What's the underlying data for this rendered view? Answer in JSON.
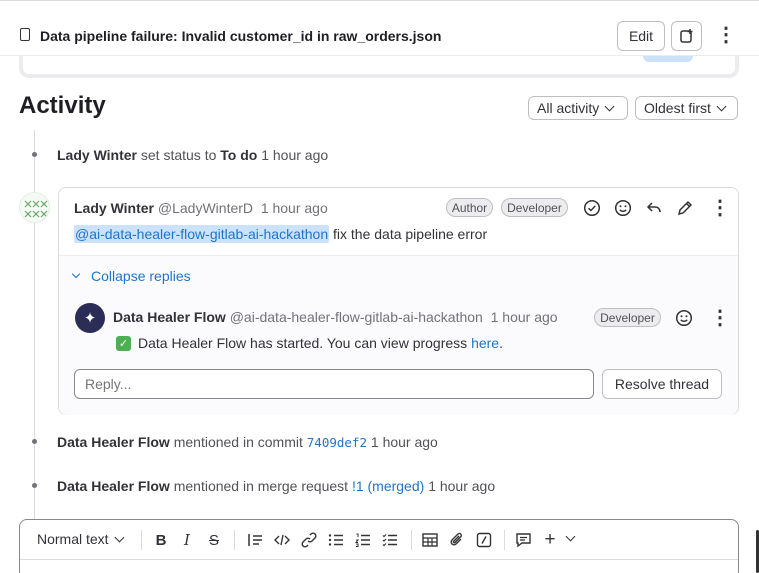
{
  "header": {
    "title": "Data pipeline failure: Invalid customer_id in raw_orders.json",
    "edit_label": "Edit"
  },
  "activity": {
    "heading": "Activity",
    "filter_label": "All activity",
    "sort_label": "Oldest first"
  },
  "notes": [
    {
      "author": "Lady Winter",
      "action": "set status to",
      "value": "To do",
      "time": "1 hour ago"
    }
  ],
  "thread": {
    "author": "Lady Winter",
    "handle": "@LadyWinterD",
    "time": "1 hour ago",
    "badges": [
      "Author",
      "Developer"
    ],
    "mention": "@ai-data-healer-flow-gitlab-ai-hackathon",
    "text": "fix the data pipeline error",
    "collapse_label": "Collapse replies",
    "reply": {
      "author": "Data Healer Flow",
      "handle": "@ai-data-healer-flow-gitlab-ai-hackathon",
      "time": "1 hour ago",
      "badge": "Developer",
      "text": "Data Healer Flow has started. You can view progress",
      "link": "here",
      "end": "."
    },
    "reply_placeholder": "Reply...",
    "resolve_label": "Resolve thread"
  },
  "mentions": [
    {
      "author": "Data Healer Flow",
      "action": "mentioned in commit",
      "ref": "7409def2",
      "time": "1 hour ago"
    },
    {
      "author": "Data Healer Flow",
      "action": "mentioned in merge request",
      "ref": "!1 (merged)",
      "time": "1 hour ago"
    }
  ],
  "editor": {
    "text_style": "Normal text",
    "toolbar_icons": [
      "bold-icon",
      "italic-icon",
      "strikethrough-icon",
      "quote-icon",
      "code-icon",
      "link-icon",
      "bullet-list-icon",
      "numbered-list-icon",
      "task-list-icon",
      "table-icon",
      "attachment-icon",
      "slash-command-icon",
      "comment-icon",
      "plus-icon"
    ]
  },
  "colors": {
    "link": "#1f75cb",
    "mention_bg": "#cbe2f9",
    "bot_avatar": "#2b2d57",
    "check": "#4caf50"
  }
}
